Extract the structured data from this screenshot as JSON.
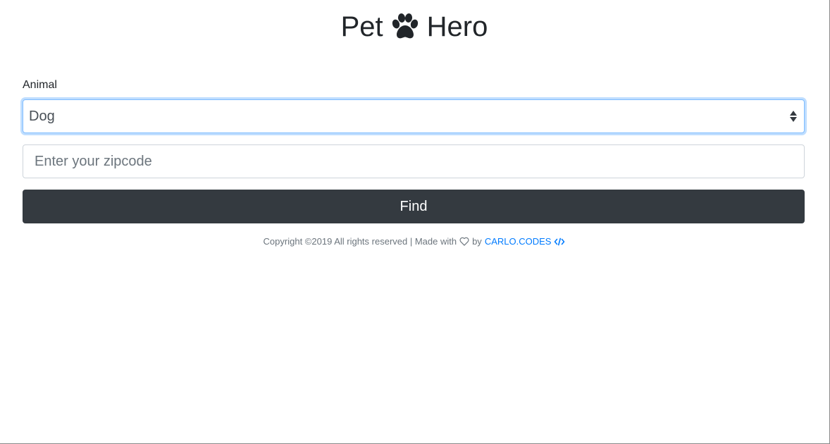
{
  "header": {
    "title_left": "Pet",
    "title_right": "Hero",
    "logo_icon": "paw-icon"
  },
  "form": {
    "animal_label": "Animal",
    "animal_selected": "Dog",
    "zipcode_placeholder": "Enter your zipcode",
    "zipcode_value": "",
    "find_label": "Find"
  },
  "footer": {
    "copyright_text": "Copyright ©2019 All rights reserved | Made with",
    "by_text": "by",
    "link_text": "CARLO.CODES",
    "heart_icon": "heart-outline-icon",
    "code_icon": "code-icon"
  },
  "colors": {
    "button_bg": "#343a40",
    "link": "#007bff",
    "focus_border": "#80bdff",
    "muted_text": "#6c757d"
  }
}
